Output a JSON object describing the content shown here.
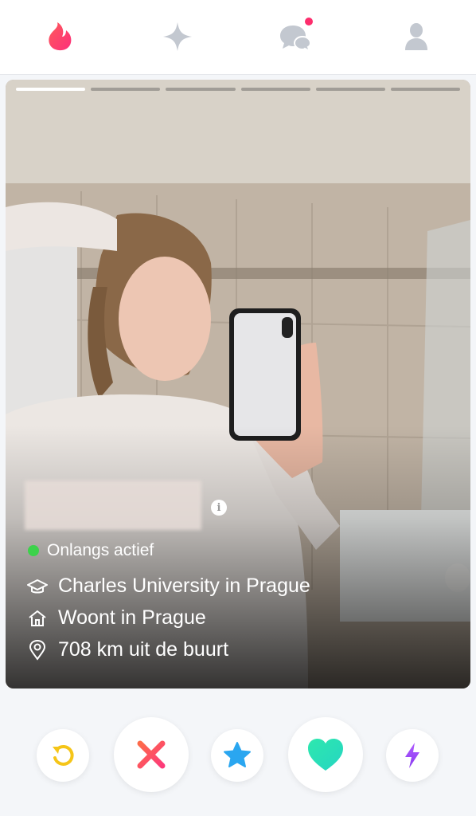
{
  "nav": {
    "icons": [
      "flame-icon",
      "sparkle-icon",
      "chat-icon",
      "profile-icon"
    ],
    "colors": {
      "flame": "#fd3a6e",
      "inactive": "#c3c8d0",
      "badge": "#fd2d6c"
    }
  },
  "card": {
    "photo_count": 6,
    "active_photo": 1,
    "status": {
      "label": "Onlangs actief",
      "color": "#3cd24b"
    },
    "school": "Charles University in Prague",
    "lives_in": "Woont in Prague",
    "distance": "708 km uit de buurt",
    "info_label": "i"
  },
  "actions": {
    "buttons": [
      {
        "name": "rewind",
        "icon": "rewind-icon",
        "color": "#f5c518"
      },
      {
        "name": "nope",
        "icon": "close-icon",
        "color": "#fd4d6a"
      },
      {
        "name": "super-like",
        "icon": "star-icon",
        "color": "#2aa6f0"
      },
      {
        "name": "like",
        "icon": "heart-icon",
        "color": "#2de5b6"
      },
      {
        "name": "boost",
        "icon": "bolt-icon",
        "color": "#9b4dff"
      }
    ]
  }
}
